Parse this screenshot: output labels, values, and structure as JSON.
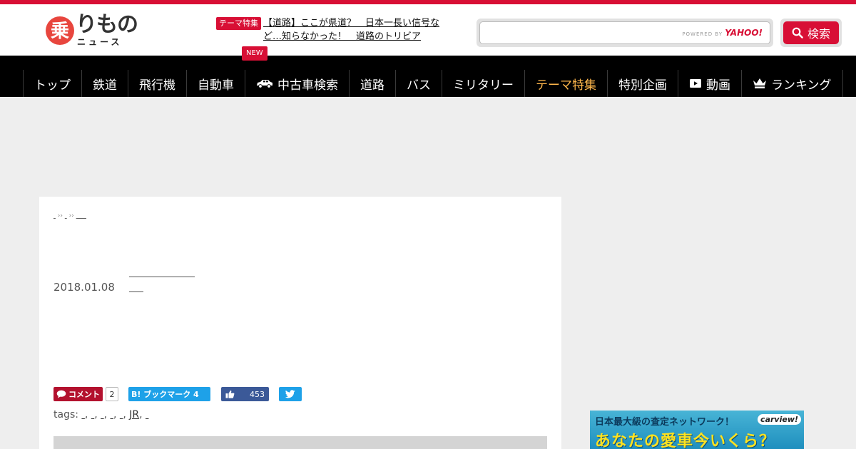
{
  "brand": {
    "logo_mark_char": "乗",
    "logo_kana": "りもの",
    "logo_sub": "ニュース",
    "accent_color": "#d80f35"
  },
  "header": {
    "theme_badge": "テーマ特集",
    "theme_link": "【道路】ここが県道？　日本一長い信号など…知らなかった！　道路のトリビア",
    "new_badge": "NEW"
  },
  "search": {
    "powered_prefix": "POWERED BY",
    "powered_brand": "YAHOO!",
    "button_label": "検索",
    "icon": "search-icon"
  },
  "nav": {
    "items": [
      {
        "label": "トップ"
      },
      {
        "label": "鉄道"
      },
      {
        "label": "飛行機"
      },
      {
        "label": "自動車"
      },
      {
        "label": "中古車検索",
        "icon": "car-icon"
      },
      {
        "label": "道路"
      },
      {
        "label": "バス"
      },
      {
        "label": "ミリタリー"
      },
      {
        "label": "テーマ特集",
        "active": true
      },
      {
        "label": "特別企画"
      },
      {
        "label": "動画",
        "icon": "video-icon"
      },
      {
        "label": "ランキング",
        "icon": "crown-icon"
      }
    ],
    "active_color": "#ffb74c"
  },
  "article": {
    "breadcrumb_sep": "››",
    "title": "",
    "date": "2018.01.08"
  },
  "share": {
    "comment_label": "コメント",
    "comment_count": "2",
    "hatena_label": "B! ブックマーク 4",
    "like_count": "453"
  },
  "tags": {
    "prefix": "tags:",
    "items": [
      "JR"
    ]
  },
  "side_ad": {
    "top_text": "日本最大級の査定ネットワーク！",
    "brand": "carview!",
    "main_text": "あなたの愛車今いくら？"
  }
}
